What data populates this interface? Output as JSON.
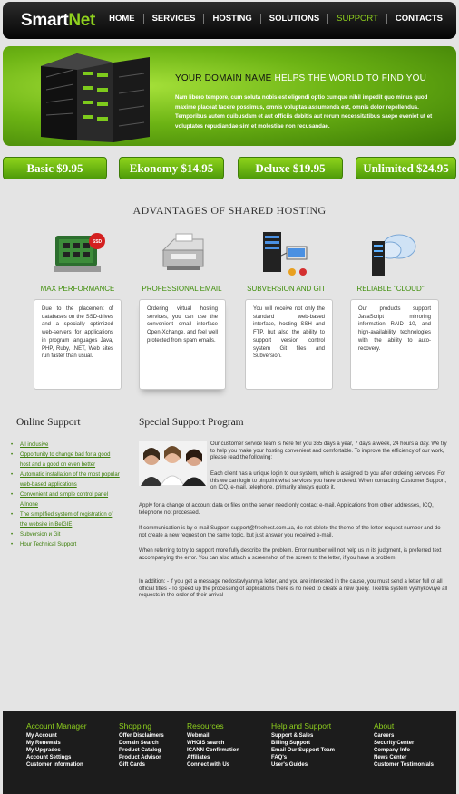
{
  "header": {
    "logo_smart": "Smart",
    "logo_net": "Net",
    "nav": [
      "HOME",
      "SERVICES",
      "HOSTING",
      "SOLUTIONS",
      "SUPPORT",
      "CONTACTS"
    ],
    "active_nav": "SUPPORT"
  },
  "hero": {
    "title_dark": "YOUR DOMAIN NAME",
    "title_light": "HELPS THE WORLD TO FIND YOU",
    "text": "Nam libero tempore, cum soluta nobis est eligendi optio cumque nihil impedit quo minus quod maxime placeat facere possimus, omnis voluptas assumenda est, omnis dolor repellendus. Temporibus autem quibusdam et aut officiis debitis aut rerum necessitatibus saepe eveniet ut et voluptates repudiandae sint et molestiae non recusandae."
  },
  "prices": [
    {
      "label": "Basic $9.95"
    },
    {
      "label": "Ekonomy $14.95"
    },
    {
      "label": "Deluxe $19.95"
    },
    {
      "label": "Unlimited $24.95"
    }
  ],
  "advantages": {
    "title": "ADVANTAGES OF SHARED HOSTING",
    "items": [
      {
        "title": "MAX PERFORMANCE",
        "icon": "ssd-drive-icon",
        "text": "Due to the placement of databases on the SSD-drives and a specially optimized web-servers for applications in program languages Java, PHP, Ruby, .NET, Web sites run faster than usual."
      },
      {
        "title": "PROFESSIONAL EMAIL",
        "icon": "email-server-icon",
        "text": "Ordering virtual hosting services, you can use the convenient email interface Open-Xchange, and feel well protected from spam emails."
      },
      {
        "title": "SUBVERSION AND GIT",
        "icon": "server-network-icon",
        "text": "You will receive not only the standard web-based interface, hosting SSH and FTP, but also the ability to support version control system Git files and Subversion."
      },
      {
        "title": "RELIABLE \"CLOUD\"",
        "icon": "cloud-server-icon",
        "text": "Our products support JavaScript mirroring information RAID 10, and high-availability technologies with the ability to auto-recovery."
      }
    ]
  },
  "online_support": {
    "title": "Online Support",
    "links": [
      "All inclusive",
      "Opportunity to change bad for a good host and a good on even better",
      "Automatic installation of the most popular web-based applications",
      "Convenient and simple control panel Allnone",
      "The simplified system of registration of the website in BelGIE",
      "Subversion и Git",
      "Hour Technical Support"
    ]
  },
  "special_support": {
    "title": "Special Support Program",
    "p1": "Our customer service team is here for you 365 days a year, 7 days a week, 24 hours a day. We try to help you make your hosting convenient and comfortable. To improve the efficiency of our work, please read the following:",
    "p2": "Each client has a unique login to our system, which is assigned to you after ordering services. For this we can login to pinpoint what services you have ordered. When contacting Customer Support, on ICQ, e-mail, telephone, primarily always quote it.",
    "p3": "Apply for a change of account data or files on the server need only contact e-mail. Applications from other addresses, ICQ, telephone not processed.",
    "p4": "If communication is by e-mail Support support@freehost.com.ua, do not delete the theme of the letter request number and do not create a new request on the same topic, but just answer you received e-mail.",
    "p5": "When referring to try to support more fully describe the problem. Error number will not help us in its judgment, is preferred text accompanying the error. You can also attach a screenshot of the screen to the letter, if you have a problem.",
    "p6": "In addition: - if you get a message nedostavlyannya letter, and you are interested in the cause, you must send a letter full of all official titles - To speed up the processing of applications there is no need to create a new query. Tiketna system vyshykovuye all requests in the order of their arrival"
  },
  "footer": [
    {
      "title": "Account Manager",
      "items": [
        "My Account",
        "My Renewals",
        "My Upgrades",
        "Account Settings",
        "Customer Information"
      ]
    },
    {
      "title": "Shopping",
      "items": [
        "Offer Disclaimers",
        "Domain Search",
        "Product Catalog",
        "Product Advisor",
        "Gift Cards"
      ]
    },
    {
      "title": "Resources",
      "items": [
        "Webmail",
        "WHOIS search",
        "ICANN Confirmation",
        "Affiliates",
        "Connect with Us"
      ]
    },
    {
      "title": "Help and Support",
      "items": [
        "Support & Sales",
        "Billing Support",
        "Email Our Support Team",
        "FAQ's",
        "User's Guides"
      ]
    },
    {
      "title": "About",
      "items": [
        "Careers",
        "Security Center",
        "Company Info",
        "News Center",
        "Customer Testimonials"
      ]
    }
  ],
  "colors": {
    "accent": "#8fd11e",
    "link": "#3a7d08",
    "footer_bg": "#1c1c1c"
  }
}
